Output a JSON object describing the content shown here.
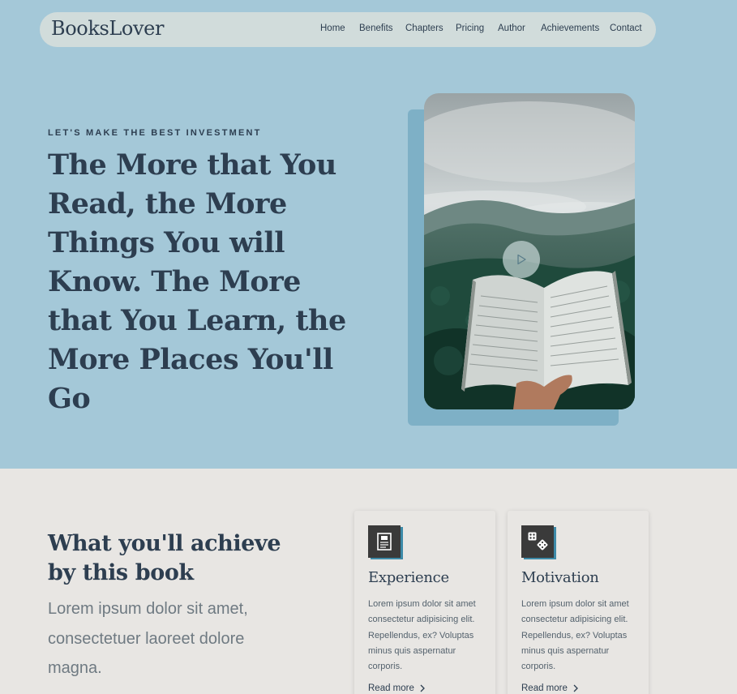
{
  "brand": {
    "logo": "BooksLover"
  },
  "nav": {
    "items": [
      "Home",
      "Benefits",
      "Chapters",
      "Pricing",
      "Author",
      "Achievements",
      "Contact"
    ]
  },
  "hero": {
    "kicker": "LET'S MAKE THE BEST INVESTMENT",
    "headline": "The More that You Read, the More Things You will Know. The More that You Learn, the More Places You'll Go",
    "media_icon": "play-icon"
  },
  "achieve": {
    "title": "What you'll achieve by this book",
    "subtitle": "Lorem ipsum dolor sit amet, consectetuer laoreet dolore magna."
  },
  "cards": [
    {
      "icon": "document-icon",
      "title": "Experience",
      "text": "Lorem ipsum dolor sit amet consectetur adipisicing elit. Repellendus, ex? Voluptas minus quis aspernatur corporis.",
      "link": "Read more"
    },
    {
      "icon": "dice-icon",
      "title": "Motivation",
      "text": "Lorem ipsum dolor sit amet consectetur adipisicing elit. Repellendus, ex? Voluptas minus quis aspernatur corporis.",
      "link": "Read more"
    }
  ],
  "colors": {
    "hero_bg": "#a4c8d8",
    "navbar_bg": "#d1dcdb",
    "section_bg": "#e8e6e3",
    "heading": "#2d3e50",
    "accent": "#3d8aa8"
  }
}
